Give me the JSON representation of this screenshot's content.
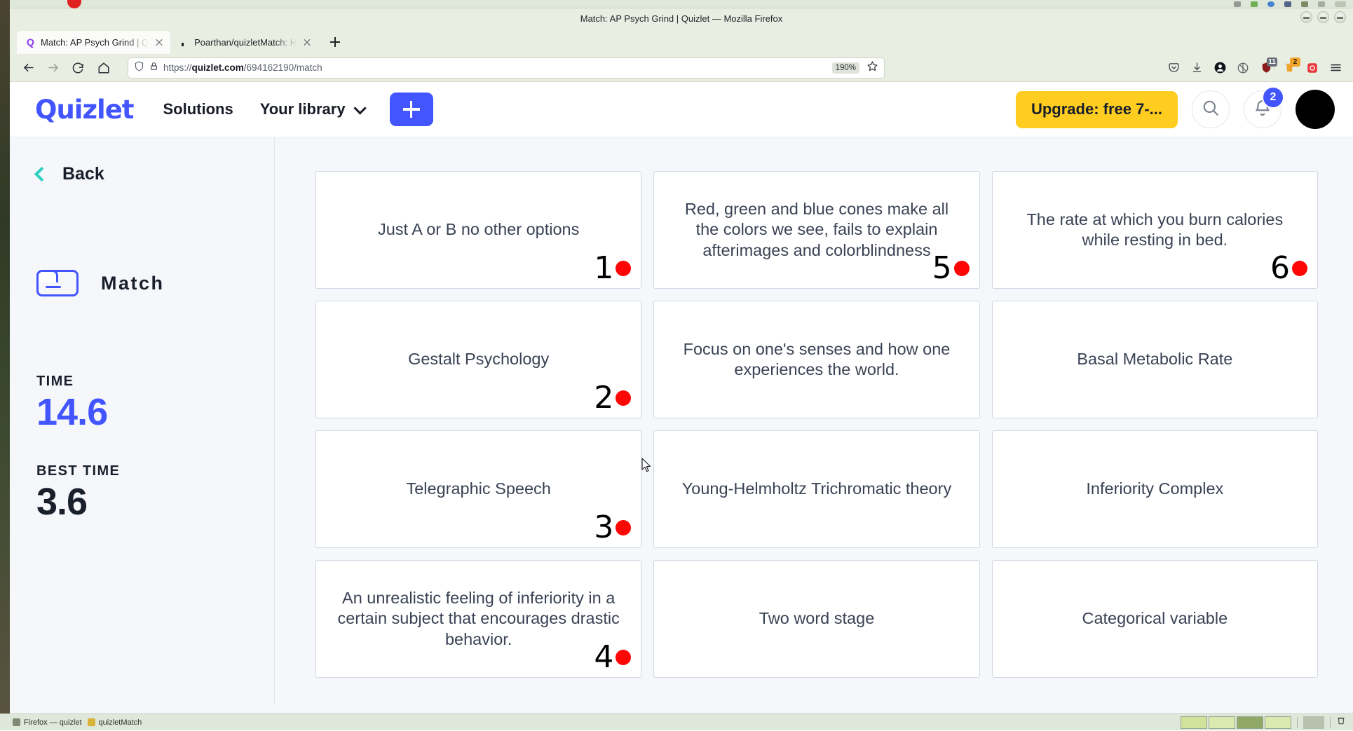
{
  "desktop": {
    "taskbar_items": [
      {
        "label": "Firefox — quizlet"
      },
      {
        "label": "quizletMatch"
      }
    ]
  },
  "browser": {
    "window_title": "Match: AP Psych Grind | Quizlet — Mozilla Firefox",
    "tabs": [
      {
        "label": "Match: AP Psych Grind | Q",
        "favicon": "quizlet-favicon",
        "active": true
      },
      {
        "label": "Poarthan/quizletMatch: H",
        "favicon": "github-favicon",
        "active": false
      }
    ],
    "new_tab_label": "+",
    "nav": {
      "back_icon": "back-arrow-icon",
      "forward_icon": "forward-arrow-icon",
      "reload_icon": "reload-icon",
      "home_icon": "home-icon"
    },
    "urlbar": {
      "shield_icon": "shield-icon",
      "lock_icon": "lock-icon",
      "url_prefix": "https://",
      "url_domain": "quizlet.com",
      "url_path": "/694162190/match",
      "zoom_level": "190%",
      "bookmark_icon": "star-icon"
    },
    "toolbar_right": {
      "pocket_icon": "pocket-icon",
      "downloads_icon": "downloads-icon",
      "account_icon": "account-icon",
      "extension_icon": "extension-icon",
      "shield_ext_badge": "11",
      "trash_ext_badge": "2",
      "opera_icon": "record-icon",
      "menu_icon": "hamburger-menu-icon"
    }
  },
  "quizlet": {
    "logo": "Quizlet",
    "nav": [
      {
        "label": "Solutions",
        "has_chevron": false
      },
      {
        "label": "Your library",
        "has_chevron": true
      }
    ],
    "create_button_label": "+",
    "upgrade_button_label": "Upgrade: free 7-...",
    "search_icon": "search-icon",
    "notifications_icon": "bell-icon",
    "notifications_count": "2",
    "avatar": "user-avatar",
    "colors": {
      "brand_blue": "#4255ff",
      "upgrade_yellow": "#ffcd1f",
      "accent_teal": "#2ecfc0",
      "marker_red": "#fc0606",
      "card_border": "#d0d7e3",
      "page_bg": "#f6f7fb"
    }
  },
  "sidebar": {
    "back_label": "Back",
    "mode_label": "Match",
    "mode_icon": "match-card-icon",
    "stats": [
      {
        "label": "TIME",
        "value": "14.6",
        "style": "blue"
      },
      {
        "label": "BEST TIME",
        "value": "3.6",
        "style": "dark"
      }
    ]
  },
  "match_grid": {
    "cards": [
      {
        "text": "Just A or B no other options",
        "marker": "1"
      },
      {
        "text": "Red, green and blue cones make all the colors we see, fails to explain afterimages and colorblindness",
        "marker": "5"
      },
      {
        "text": "The rate at which you burn calories while resting in bed.",
        "marker": "6"
      },
      {
        "text": "Gestalt Psychology",
        "marker": "2"
      },
      {
        "text": "Focus on one's senses and how one experiences the world.",
        "marker": ""
      },
      {
        "text": "Basal Metabolic Rate",
        "marker": ""
      },
      {
        "text": "Telegraphic Speech",
        "marker": "3"
      },
      {
        "text": "Young-Helmholtz Trichromatic theory",
        "marker": ""
      },
      {
        "text": "Inferiority Complex",
        "marker": ""
      },
      {
        "text": "An unrealistic feeling of inferiority in a certain subject that encourages drastic behavior.",
        "marker": "4"
      },
      {
        "text": "Two word stage",
        "marker": ""
      },
      {
        "text": "Categorical variable",
        "marker": ""
      }
    ]
  }
}
